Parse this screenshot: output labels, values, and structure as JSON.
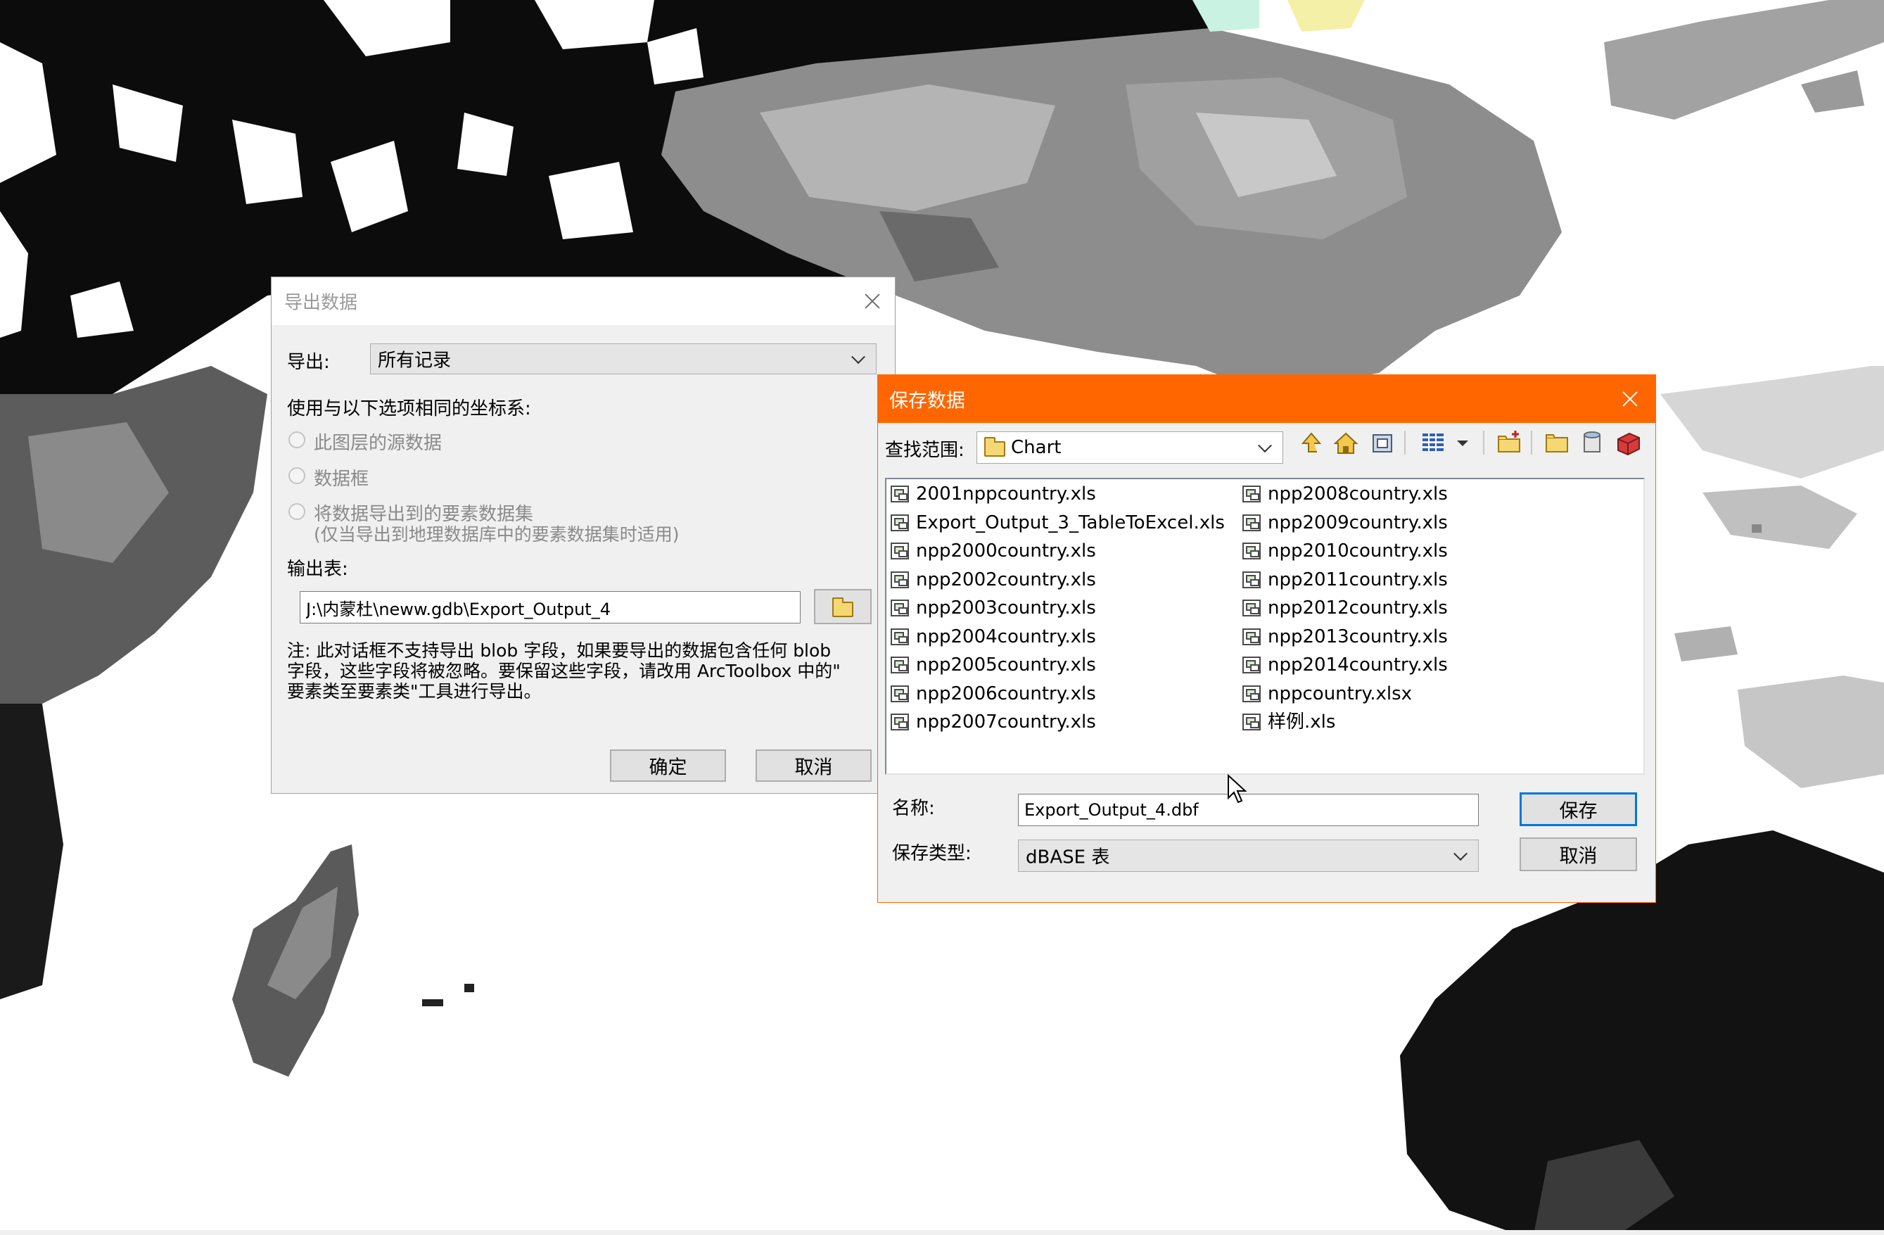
{
  "export_dialog": {
    "title": "导出数据",
    "export_label": "导出:",
    "export_value": "所有记录",
    "coord_label": "使用与以下选项相同的坐标系:",
    "radio_options": [
      "此图层的源数据",
      "数据框",
      "将数据导出到的要素数据集"
    ],
    "radio_note": "(仅当导出到地理数据库中的要素数据集时适用)",
    "output_label": "输出表:",
    "output_value": "J:\\内蒙杜\\neww.gdb\\Export_Output_4",
    "note_lines": [
      "注: 此对话框不支持导出 blob 字段，如果要导出的数据包含任何 blob",
      "字段，这些字段将被忽略。要保留这些字段，请改用 ArcToolbox 中的\"",
      "要素类至要素类\"工具进行导出。"
    ],
    "ok_label": "确定",
    "cancel_label": "取消"
  },
  "save_dialog": {
    "title": "保存数据",
    "title_bar_color": "#ff6600",
    "lookin_label": "查找范围:",
    "lookin_value": "Chart",
    "toolbar_icons": [
      "up-one-level-icon",
      "home-icon",
      "connect-folder-icon",
      "list-view-icon",
      "view-menu-arrow-icon",
      "new-folder-icon",
      "folder-icon",
      "database-icon",
      "toolbox-icon"
    ],
    "files_col1": [
      "2001nppcountry.xls",
      "Export_Output_3_TableToExcel.xls",
      "npp2000country.xls",
      "npp2002country.xls",
      "npp2003country.xls",
      "npp2004country.xls",
      "npp2005country.xls",
      "npp2006country.xls",
      "npp2007country.xls"
    ],
    "files_col2": [
      "npp2008country.xls",
      "npp2009country.xls",
      "npp2010country.xls",
      "npp2011country.xls",
      "npp2012country.xls",
      "npp2013country.xls",
      "npp2014country.xls",
      "nppcountry.xlsx",
      "样例.xls"
    ],
    "name_label": "名称:",
    "name_value": "Export_Output_4.dbf",
    "type_label": "保存类型:",
    "type_value": "dBASE 表",
    "save_label": "保存",
    "cancel_label": "取消"
  },
  "colors": {
    "accent": "#0078d7",
    "dialog_bg": "#f0f0f0"
  }
}
